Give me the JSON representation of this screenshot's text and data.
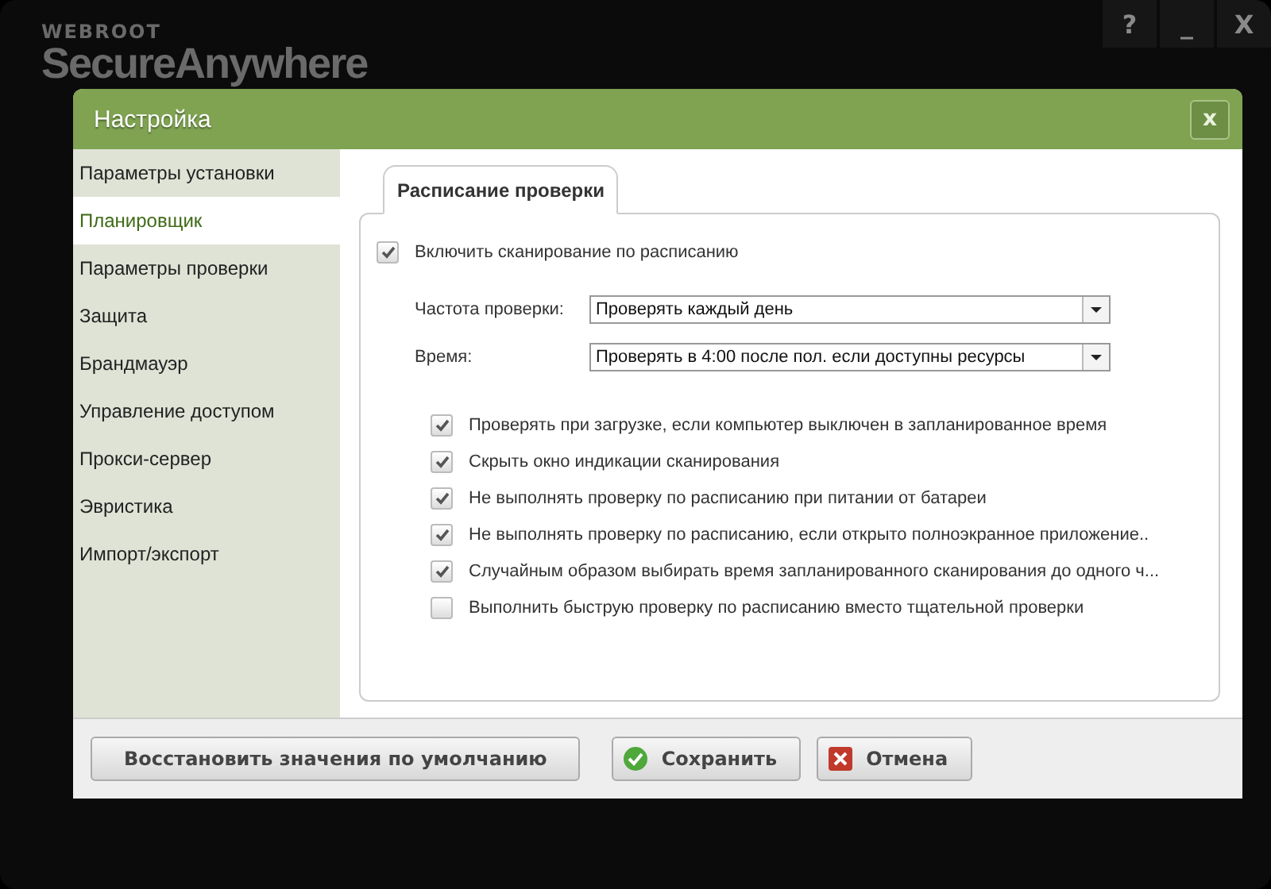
{
  "app": {
    "logo_top": "WEBROOT",
    "logo_bottom": "SecureAnywhere",
    "controls": [
      "?",
      "_",
      "X"
    ]
  },
  "dialog": {
    "title": "Настройка",
    "close": "x"
  },
  "sidebar": {
    "items": [
      {
        "label": "Параметры установки",
        "selected": false
      },
      {
        "label": "Планировщик",
        "selected": true
      },
      {
        "label": "Параметры проверки",
        "selected": false
      },
      {
        "label": "Защита",
        "selected": false
      },
      {
        "label": "Брандмауэр",
        "selected": false
      },
      {
        "label": "Управление доступом",
        "selected": false
      },
      {
        "label": "Прокси-сервер",
        "selected": false
      },
      {
        "label": "Эвристика",
        "selected": false
      },
      {
        "label": "Импорт/экспорт",
        "selected": false
      }
    ]
  },
  "tabs": [
    {
      "label": "Расписание проверки",
      "selected": true
    }
  ],
  "enable": {
    "label": "Включить сканирование по расписанию",
    "checked": true
  },
  "fields": [
    {
      "label": "Частота проверки:",
      "value": "Проверять каждый день"
    },
    {
      "label": "Время:",
      "value": "Проверять в 4:00 после пол. если доступны ресурсы"
    }
  ],
  "options": [
    {
      "label": "Проверять при загрузке, если компьютер выключен в запланированное время",
      "checked": true
    },
    {
      "label": "Скрыть окно индикации сканирования",
      "checked": true
    },
    {
      "label": "Не выполнять проверку по расписанию при питании от батареи",
      "checked": true
    },
    {
      "label": "Не выполнять проверку по расписанию, если открыто полноэкранное приложение..",
      "checked": true
    },
    {
      "label": "Случайным образом выбирать время запланированного сканирования до одного ч...",
      "checked": true
    },
    {
      "label": "Выполнить быструю проверку по расписанию вместо тщательной проверки",
      "checked": false
    }
  ],
  "buttons": [
    {
      "label": "Восстановить значения по умолчанию",
      "kind": "plain"
    },
    {
      "label": "Сохранить",
      "kind": "save"
    },
    {
      "label": "Отмена",
      "kind": "cancel"
    }
  ]
}
